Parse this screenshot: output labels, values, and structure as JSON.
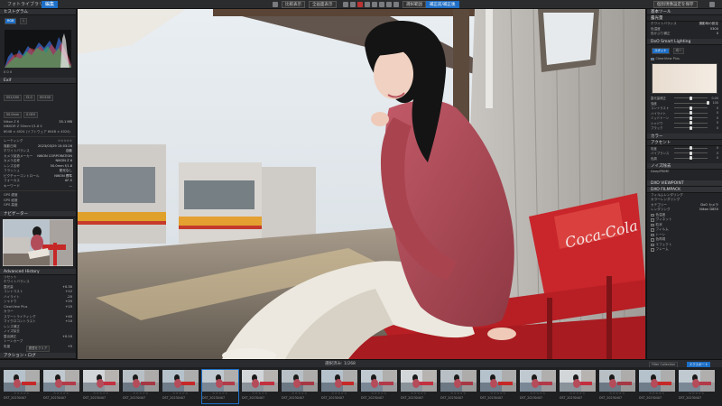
{
  "topbar": {
    "tabs": [
      "フォトライブラリ",
      "編集"
    ],
    "buttons": [
      "比較表示",
      "全画面表示",
      "選択範囲",
      "補正前/補正後"
    ],
    "right_buttons": [
      "個別現像設定を保存",
      "書き出し"
    ]
  },
  "left_panel": {
    "histogram_title": "ヒストグラム",
    "histogram_modes": [
      "RGB",
      "L"
    ],
    "histogram_readout": "0   0   0",
    "exif_title": "Exif",
    "exif_buttons": [
      "SS1/160",
      "f2.0",
      "ISO100",
      "50.0mm",
      "0.0EV"
    ],
    "file_info": [
      {
        "k": "Nikon Z 6",
        "v": "35.1 MB"
      },
      {
        "k": "NIKKOR Z 50mm f/1.8 S",
        "v": ""
      },
      {
        "k": "6048 × 4024 (ソフトウェア 6048 × 4024)",
        "v": ""
      }
    ],
    "meta_rows": [
      {
        "k": "レーティング",
        "v": "☆☆☆☆☆"
      },
      {
        "k": "撮影日時",
        "v": "2023/03/29 15:03:26"
      },
      {
        "k": "ホワイトバランス",
        "v": "自動"
      },
      {
        "k": "カメラ製造メーカー",
        "v": "NIKON CORPORATION"
      },
      {
        "k": "カメラ名称",
        "v": "NIKON Z 6"
      },
      {
        "k": "レンズ名称",
        "v": "50.0mm f/1.8"
      },
      {
        "k": "フラッシュ",
        "v": "発光なし"
      },
      {
        "k": "ピクチャーコントロール",
        "v": "NIKON 標準"
      },
      {
        "k": "フォーカス",
        "v": "AF-S"
      },
      {
        "k": "キーワード",
        "v": "—"
      }
    ],
    "gps_rows": [
      {
        "k": "GPS 緯度",
        "v": ""
      },
      {
        "k": "GPS 経度",
        "v": ""
      },
      {
        "k": "GPS 高度",
        "v": ""
      }
    ],
    "nav_title": "ナビゲーター",
    "adv_title": "Advanced History",
    "history_items": [
      "リセット",
      "ホワイトバランス",
      "露光量",
      "コントラスト",
      "ハイライト",
      "シャドウ",
      "ClearView Plus",
      "カラー",
      "スマートライティング",
      "マイクロコントラスト",
      "レンズ補正",
      "ノイズ除去",
      "露出補正",
      "トーンカーブ",
      "彩度"
    ],
    "history_values": [
      "",
      "",
      "+0.30",
      "+12",
      "-20",
      "+25",
      "+15",
      "",
      "+40",
      "+10",
      "",
      "",
      "+0.10",
      "",
      "+5"
    ],
    "footer_button": "履歴をクリア",
    "footer_title": "アクション・ログ"
  },
  "right_panel": {
    "section1_title": "基本ツール",
    "ev_title": "露光量",
    "ev_rows": [
      {
        "k": "ホワイトバランス",
        "v": "撮影時の設定"
      },
      {
        "k": "色温度",
        "v": "5300"
      },
      {
        "k": "色かぶり補正",
        "v": "0"
      }
    ],
    "smart_title": "DxO Smart Lighting",
    "smart_modes": [
      "スポット",
      "均一",
      "ClearView Plus"
    ],
    "sliders": [
      {
        "label": "露光量補正",
        "value": "0.00",
        "pos": 0.5
      },
      {
        "label": "強度",
        "value": "100",
        "pos": 1.0
      },
      {
        "label": "コントラスト",
        "value": "0",
        "pos": 0.5
      },
      {
        "label": "ハイライト",
        "value": "0",
        "pos": 0.5
      },
      {
        "label": "ミッドトーン",
        "value": "0",
        "pos": 0.5
      },
      {
        "label": "シャドウ",
        "value": "0",
        "pos": 0.5
      },
      {
        "label": "ブラック",
        "value": "0",
        "pos": 0.5
      }
    ],
    "color_title": "カラー",
    "color_sub": "アクセント",
    "color_sliders": [
      {
        "label": "彩度",
        "value": "0",
        "pos": 0.5
      },
      {
        "label": "バイブランス",
        "value": "0",
        "pos": 0.5
      },
      {
        "label": "色調",
        "value": "0",
        "pos": 0.5
      }
    ],
    "noise_title": "ノイズ除去",
    "noise_value": "DeepPRIME",
    "lens_title": "DXO VIEWPOINT",
    "film_title": "DXO FILMPACK",
    "film_rows": [
      "フィルムレンダリング",
      "カラーレンダリング",
      "カテゴリー",
      "レンダリング"
    ],
    "film_values": [
      "",
      "",
      "DxO カメラ",
      "Nikon D850"
    ],
    "bottom_rows": [
      "色温度",
      "ヴィネット",
      "粒状",
      "フィルム",
      "トーン",
      "色再現",
      "エフェクト",
      "フレーム"
    ]
  },
  "filmstrip": {
    "label": "選択済み: 1/268",
    "filter_label": "Filter Collection",
    "export_label": "エクスポート",
    "stars": "☆☆☆☆☆",
    "names": [
      "DST_20230407",
      "DST_20230407",
      "DST_20230407",
      "DST_20230407",
      "DST_20230407",
      "DST_20230407",
      "DST_20230407",
      "DST_20230407",
      "DST_20230407",
      "DST_20230407",
      "DST_20230407",
      "DST_20230407",
      "DST_20230407",
      "DST_20230407",
      "DST_20230407",
      "DST_20230407",
      "DST_20230407",
      "DST_20230407"
    ]
  }
}
